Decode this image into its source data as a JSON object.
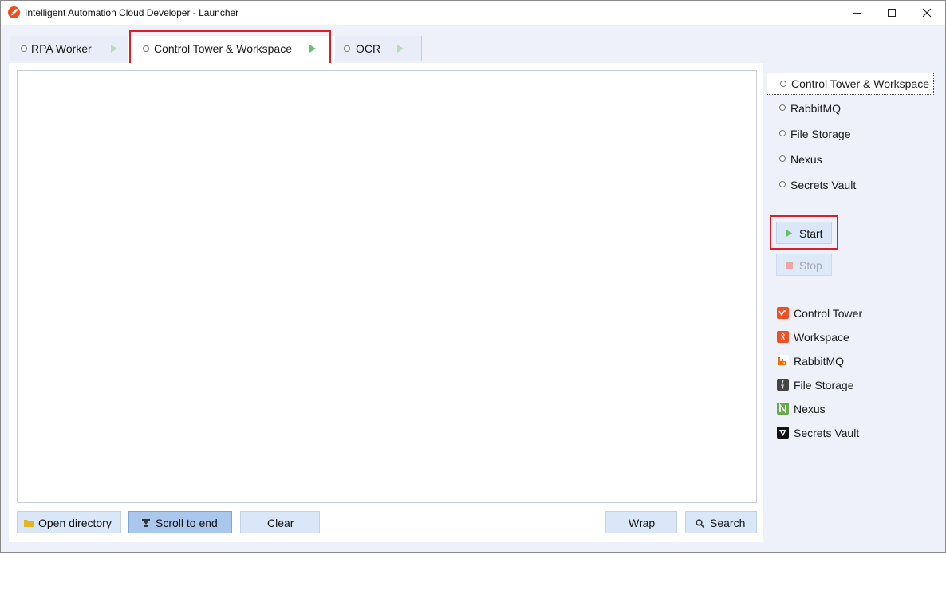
{
  "window": {
    "title": "Intelligent Automation Cloud Developer - Launcher"
  },
  "tabs": [
    {
      "label": "RPA Worker"
    },
    {
      "label": "Control Tower & Workspace"
    },
    {
      "label": "OCR"
    }
  ],
  "active_tab": "Control Tower & Workspace",
  "toolbar": {
    "open_directory": "Open directory",
    "scroll_to_end": "Scroll to end",
    "clear": "Clear",
    "wrap": "Wrap",
    "search": "Search"
  },
  "services": [
    {
      "label": "Control Tower & Workspace"
    },
    {
      "label": "RabbitMQ"
    },
    {
      "label": "File Storage"
    },
    {
      "label": "Nexus"
    },
    {
      "label": "Secrets Vault"
    }
  ],
  "selected_service": "Control Tower & Workspace",
  "actions": {
    "start": "Start",
    "stop": "Stop"
  },
  "links": [
    {
      "label": "Control Tower",
      "icon": "control-tower-icon",
      "color": "#f04e23"
    },
    {
      "label": "Workspace",
      "icon": "workspace-icon",
      "color": "#f04e23"
    },
    {
      "label": "RabbitMQ",
      "icon": "rabbitmq-icon",
      "color": "#ff6600"
    },
    {
      "label": "File Storage",
      "icon": "file-storage-icon",
      "color": "#444444"
    },
    {
      "label": "Nexus",
      "icon": "nexus-icon",
      "color": "#6aa84f"
    },
    {
      "label": "Secrets Vault",
      "icon": "vault-icon",
      "color": "#111111"
    }
  ],
  "colors": {
    "accent_highlight": "#d9202a",
    "button_bg": "#d9e7f8",
    "button_pressed": "#aac8ee",
    "play_green": "#6cbf6c",
    "stop_red": "#f08c8c"
  }
}
